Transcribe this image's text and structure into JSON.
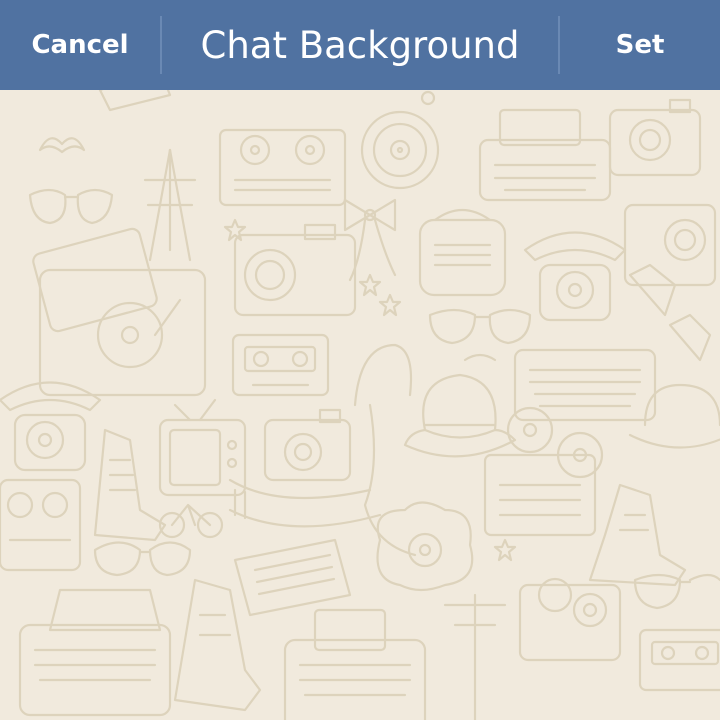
{
  "header": {
    "cancel_label": "Cancel",
    "title": "Chat Background",
    "set_label": "Set"
  },
  "colors": {
    "header_bg": "#5072a1",
    "header_divider": "#7f9cc4",
    "wallpaper_bg": "#f1eadd",
    "doodle_stroke": "#ddd3bc"
  },
  "wallpaper": {
    "style": "retro doodle pattern",
    "icons": [
      "reel-to-reel-tape-recorder-icon",
      "vinyl-record-icon",
      "typewriter-icon",
      "vintage-camera-icon",
      "sunglasses-icon",
      "easel-icon",
      "bow-tie-icon",
      "radio-icon",
      "rotary-phone-icon",
      "record-player-icon",
      "cassette-tape-icon",
      "microphone-icon",
      "fedora-hat-icon",
      "film-projector-icon",
      "television-icon",
      "sneaker-icon",
      "scarf-icon",
      "bicycle-icon",
      "newspaper-icon",
      "utility-pole-icon",
      "star-icon",
      "mustache-icon"
    ]
  }
}
